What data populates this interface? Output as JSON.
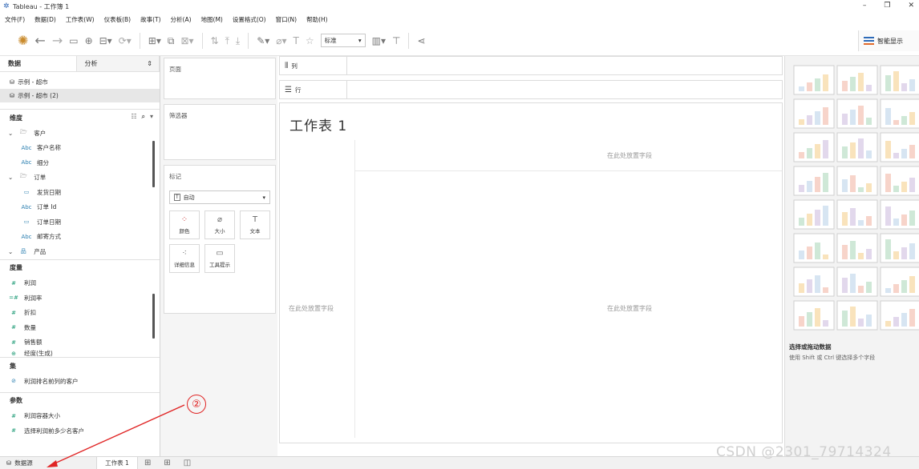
{
  "window": {
    "title": "Tableau - 工作簿 1",
    "minimize": "–",
    "restore": "❐",
    "close": "✕"
  },
  "menu": [
    "文件(F)",
    "数据(D)",
    "工作表(W)",
    "仪表板(B)",
    "故事(T)",
    "分析(A)",
    "地图(M)",
    "设置格式(O)",
    "窗口(N)",
    "帮助(H)"
  ],
  "toolbar": {
    "fit_select": "标准",
    "show_me": "智能显示"
  },
  "left_pane": {
    "tab_data": "数据",
    "tab_analysis": "分析",
    "datasources": [
      "示例 - 超市",
      "示例 - 超市 (2)"
    ],
    "dimensions_label": "维度",
    "dimension_items": [
      {
        "type": "folder",
        "label": "客户"
      },
      {
        "type": "abc",
        "label": "客户名称"
      },
      {
        "type": "abc",
        "label": "细分"
      },
      {
        "type": "folder",
        "label": "订单"
      },
      {
        "type": "date",
        "label": "发货日期"
      },
      {
        "type": "abc",
        "label": "订单 Id"
      },
      {
        "type": "date",
        "label": "订单日期"
      },
      {
        "type": "abc",
        "label": "邮寄方式"
      },
      {
        "type": "hierarchy",
        "label": "产品"
      }
    ],
    "measures_label": "度量",
    "measure_items": [
      "利润",
      "利润率",
      "折扣",
      "数量",
      "销售额",
      "经度(生成)"
    ],
    "sets_label": "集",
    "set_items": [
      "利润排名前列的客户"
    ],
    "params_label": "参数",
    "param_items": [
      "利润容器大小",
      "选择利润前多少名客户"
    ],
    "icons": {
      "abc": "Abc",
      "measure": "#",
      "calc_measure": "=#"
    }
  },
  "shelves": {
    "pages": "页面",
    "filters": "筛选器",
    "marks": "标记",
    "mark_type": "自动",
    "mark_buttons": [
      "颜色",
      "大小",
      "文本",
      "详细信息",
      "工具提示"
    ],
    "columns": "列",
    "rows": "行"
  },
  "viz": {
    "sheet_title": "工作表 1",
    "drop_field_top": "在此处放置字段",
    "drop_field_left": "在此处放置字段",
    "drop_field_center": "在此处放置字段"
  },
  "show_me": {
    "hint_title": "选择或拖动数据",
    "hint_text": "使用 Shift 或 Ctrl 键选择多个字段"
  },
  "bottom": {
    "datasource_tab": "数据源",
    "sheet_tab": "工作表 1"
  },
  "annotation": {
    "number": "②"
  },
  "watermark": "CSDN @2301_79714324"
}
